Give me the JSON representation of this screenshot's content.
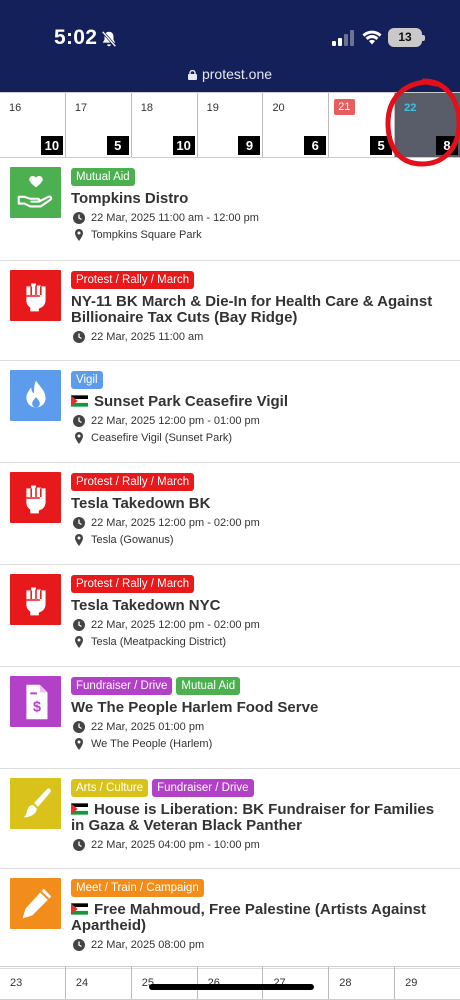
{
  "status_bar": {
    "time": "5:02",
    "battery": "13"
  },
  "browser": {
    "url": "protest.one"
  },
  "calendar_top": [
    {
      "day": "16",
      "count": "10"
    },
    {
      "day": "17",
      "count": "5"
    },
    {
      "day": "18",
      "count": "10"
    },
    {
      "day": "19",
      "count": "9"
    },
    {
      "day": "20",
      "count": "6"
    },
    {
      "day": "21",
      "count": "5",
      "today": true
    },
    {
      "day": "22",
      "count": "8",
      "selected": true
    }
  ],
  "calendar_bottom": [
    {
      "day": "23"
    },
    {
      "day": "24"
    },
    {
      "day": "25"
    },
    {
      "day": "26"
    },
    {
      "day": "27"
    },
    {
      "day": "28"
    },
    {
      "day": "29"
    }
  ],
  "events": [
    {
      "icon": "hand-heart-icon",
      "color": "#4caf50",
      "tags": [
        {
          "label": "Mutual Aid",
          "color": "#4caf50"
        }
      ],
      "flag": false,
      "title": "Tompkins Distro",
      "datetime": "22 Mar, 2025 11:00 am - 12:00 pm",
      "location": "Tompkins Square Park"
    },
    {
      "icon": "raised-fist-icon",
      "color": "#e8191a",
      "tags": [
        {
          "label": "Protest / Rally / March",
          "color": "#e8191a"
        }
      ],
      "flag": false,
      "title": "NY-11 BK March & Die-In for Health Care & Against Billionaire Tax Cuts (Bay Ridge)",
      "datetime": "22 Mar, 2025 11:00 am",
      "location": ""
    },
    {
      "icon": "candle-flame-icon",
      "color": "#5d9cec",
      "tags": [
        {
          "label": "Vigil",
          "color": "#5d9cec"
        }
      ],
      "flag": true,
      "title": "Sunset Park Ceasefire Vigil",
      "datetime": "22 Mar, 2025 12:00 pm - 01:00 pm",
      "location": "Ceasefire Vigil (Sunset Park)"
    },
    {
      "icon": "raised-fist-icon",
      "color": "#e8191a",
      "tags": [
        {
          "label": "Protest / Rally / March",
          "color": "#e8191a"
        }
      ],
      "flag": false,
      "title": "Tesla Takedown BK",
      "datetime": "22 Mar, 2025 12:00 pm - 02:00 pm",
      "location": "Tesla (Gowanus)"
    },
    {
      "icon": "raised-fist-icon",
      "color": "#e8191a",
      "tags": [
        {
          "label": "Protest / Rally / March",
          "color": "#e8191a"
        }
      ],
      "flag": false,
      "title": "Tesla Takedown NYC",
      "datetime": "22 Mar, 2025 12:00 pm - 02:00 pm",
      "location": "Tesla (Meatpacking District)"
    },
    {
      "icon": "dollar-document-icon",
      "color": "#b341c7",
      "tags": [
        {
          "label": "Fundraiser / Drive",
          "color": "#b341c7"
        },
        {
          "label": "Mutual Aid",
          "color": "#4caf50"
        }
      ],
      "flag": false,
      "title": "We The People Harlem Food Serve",
      "datetime": "22 Mar, 2025 01:00 pm",
      "location": "We The People (Harlem)"
    },
    {
      "icon": "paintbrush-icon",
      "color": "#d9c21a",
      "tags": [
        {
          "label": "Arts / Culture",
          "color": "#d9c21a"
        },
        {
          "label": "Fundraiser / Drive",
          "color": "#b341c7"
        }
      ],
      "flag": true,
      "title": "House is Liberation: BK Fundraiser for Families in Gaza & Veteran Black Panther",
      "datetime": "22 Mar, 2025 04:00 pm - 10:00 pm",
      "location": ""
    },
    {
      "icon": "pencil-icon",
      "color": "#f28c1a",
      "tags": [
        {
          "label": "Meet / Train / Campaign",
          "color": "#f28c1a"
        }
      ],
      "flag": true,
      "title": "Free Mahmoud, Free Palestine (Artists Against Apartheid)",
      "datetime": "22 Mar, 2025 08:00 pm",
      "location": ""
    }
  ]
}
